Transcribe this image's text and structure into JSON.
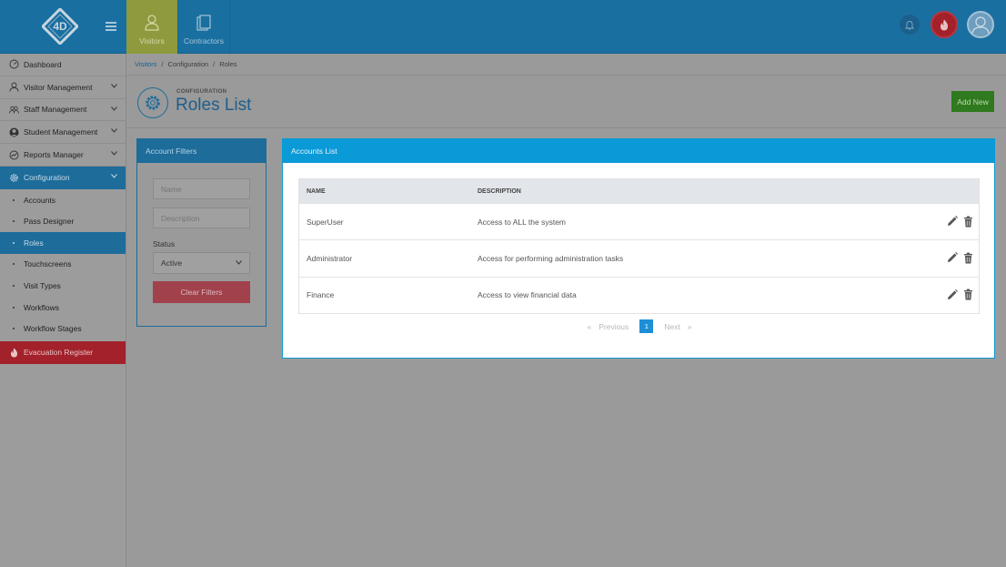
{
  "topnav": {
    "items": [
      {
        "label": "Visitors",
        "icon": "user-icon",
        "active": true
      },
      {
        "label": "Contractors",
        "icon": "document-icon",
        "active": false
      }
    ]
  },
  "logo_text": "4D",
  "sidebar": {
    "items": [
      {
        "label": "Dashboard",
        "icon": "dashboard-icon"
      },
      {
        "label": "Visitor Management",
        "icon": "user-icon"
      },
      {
        "label": "Staff Management",
        "icon": "group-icon"
      },
      {
        "label": "Student Management",
        "icon": "student-icon"
      },
      {
        "label": "Reports Manager",
        "icon": "chart-icon"
      },
      {
        "label": "Configuration",
        "icon": "gear-icon"
      }
    ],
    "sub_items": [
      {
        "label": "Accounts"
      },
      {
        "label": "Pass Designer"
      },
      {
        "label": "Roles"
      },
      {
        "label": "Touchscreens"
      },
      {
        "label": "Visit Types"
      },
      {
        "label": "Workflows"
      },
      {
        "label": "Workflow Stages"
      }
    ],
    "evacuation": {
      "label": "Evacuation Register",
      "icon": "flame-icon"
    }
  },
  "breadcrumb": {
    "items": [
      "Visitors",
      "Configuration",
      "Roles"
    ],
    "separator": "/"
  },
  "page": {
    "overline": "CONFIGURATION",
    "title": "Roles List",
    "add_new": "Add New"
  },
  "filters": {
    "title": "Account Filters",
    "name_placeholder": "Name",
    "description_placeholder": "Description",
    "status_label": "Status",
    "status_value": "Active",
    "clear_label": "Clear Filters"
  },
  "accounts": {
    "title": "Accounts List",
    "columns": [
      "NAME",
      "DESCRIPTION"
    ],
    "rows": [
      {
        "name": "SuperUser",
        "description": "Access to ALL the system"
      },
      {
        "name": "Administrator",
        "description": "Access for performing administration tasks"
      },
      {
        "name": "Finance",
        "description": "Access to view financial data"
      }
    ]
  },
  "pagination": {
    "first": "«",
    "previous": "Previous",
    "page": "1",
    "next": "Next",
    "last": "»"
  },
  "colors": {
    "topbar": "#1a6fa1",
    "accent": "#0a9ad8",
    "add_new": "#2f7a1e",
    "evac": "#a3212a"
  }
}
